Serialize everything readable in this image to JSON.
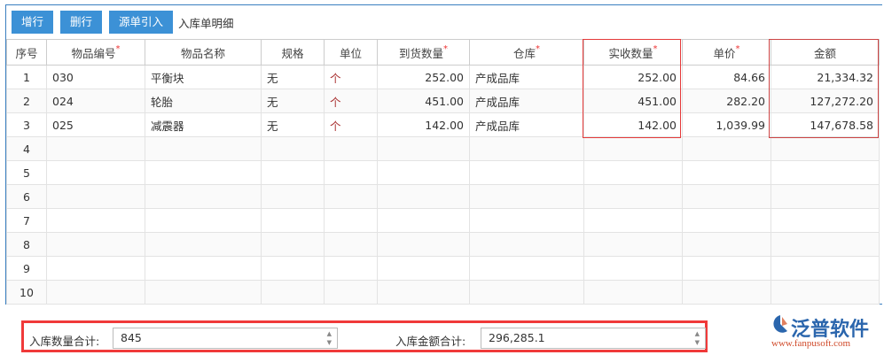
{
  "toolbar": {
    "add_row": "增行",
    "delete_row": "删行",
    "import_source": "源单引入",
    "title": "入库单明细"
  },
  "columns": [
    {
      "label": "序号",
      "required": false
    },
    {
      "label": "物品编号",
      "required": true
    },
    {
      "label": "物品名称",
      "required": false
    },
    {
      "label": "规格",
      "required": false
    },
    {
      "label": "单位",
      "required": false
    },
    {
      "label": "到货数量",
      "required": true
    },
    {
      "label": "仓库",
      "required": true
    },
    {
      "label": "实收数量",
      "required": true
    },
    {
      "label": "单价",
      "required": true
    },
    {
      "label": "金额",
      "required": false
    }
  ],
  "required_mark": "*",
  "rows": [
    [
      "1",
      "030",
      "平衡块",
      "无",
      "个",
      "252.00",
      "产成品库",
      "252.00",
      "84.66",
      "21,334.32"
    ],
    [
      "2",
      "024",
      "轮胎",
      "无",
      "个",
      "451.00",
      "产成品库",
      "451.00",
      "282.20",
      "127,272.20"
    ],
    [
      "3",
      "025",
      "减震器",
      "无",
      "个",
      "142.00",
      "产成品库",
      "142.00",
      "1,039.99",
      "147,678.58"
    ],
    [
      "4",
      "",
      "",
      "",
      "",
      "",
      "",
      "",
      "",
      ""
    ],
    [
      "5",
      "",
      "",
      "",
      "",
      "",
      "",
      "",
      "",
      ""
    ],
    [
      "6",
      "",
      "",
      "",
      "",
      "",
      "",
      "",
      "",
      ""
    ],
    [
      "7",
      "",
      "",
      "",
      "",
      "",
      "",
      "",
      "",
      ""
    ],
    [
      "8",
      "",
      "",
      "",
      "",
      "",
      "",
      "",
      "",
      ""
    ],
    [
      "9",
      "",
      "",
      "",
      "",
      "",
      "",
      "",
      "",
      ""
    ],
    [
      "10",
      "",
      "",
      "",
      "",
      "",
      "",
      "",
      "",
      ""
    ]
  ],
  "summary": {
    "qty_label": "入库数量合计:",
    "qty_value": "845",
    "amount_label": "入库金额合计:",
    "amount_value": "296,285.1"
  },
  "logo": {
    "name": "泛普软件",
    "url": "www.fanpusoft.com"
  }
}
